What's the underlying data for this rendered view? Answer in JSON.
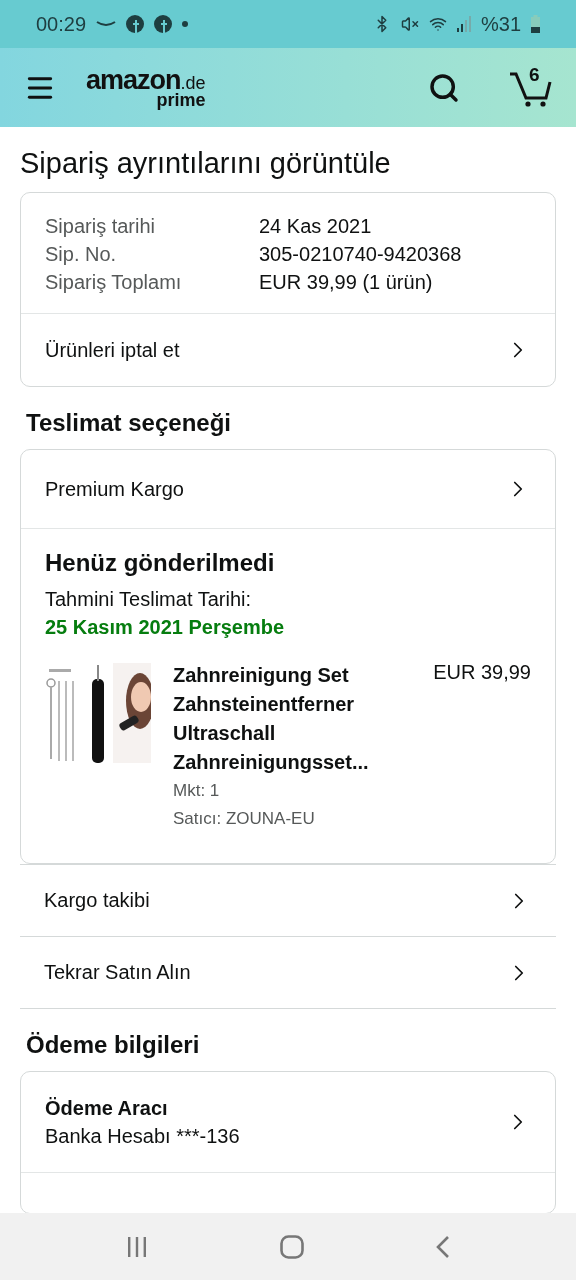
{
  "status_bar": {
    "time": "00:29",
    "battery": "%31"
  },
  "header": {
    "logo": {
      "brand": "amazon",
      "domain": ".de",
      "program": "prime"
    },
    "cart_count": "6"
  },
  "title": "Sipariş ayrıntılarını görüntüle",
  "order_summary": {
    "fields": [
      {
        "label": "Sipariş tarihi",
        "value": "24 Kas 2021"
      },
      {
        "label": "Sip. No.",
        "value": "305-0210740-9420368"
      },
      {
        "label": "Sipariş Toplamı",
        "value": "EUR 39,99 (1 ürün)"
      }
    ],
    "action": "Ürünleri iptal et"
  },
  "delivery": {
    "heading": "Teslimat seçeneği",
    "option": "Premium Kargo",
    "shipment": {
      "status": "Henüz gönderilmedi",
      "estimate_label": "Tahmini Teslimat Tarihi:",
      "estimate_date": "25 Kasım 2021 Perşembe",
      "item": {
        "name": "Zahnreinigung Set Zahnsteinentferner Ultraschall Zahnreinigungsset...",
        "price": "EUR 39,99",
        "quantity": "Mkt: 1",
        "seller": "Satıcı: ZOUNA-EU"
      }
    }
  },
  "links": [
    "Kargo takibi",
    "Tekrar Satın Alın"
  ],
  "payment": {
    "heading": "Ödeme bilgileri",
    "method": {
      "label": "Ödeme Aracı",
      "value": "Banka Hesabı ***-136"
    }
  }
}
